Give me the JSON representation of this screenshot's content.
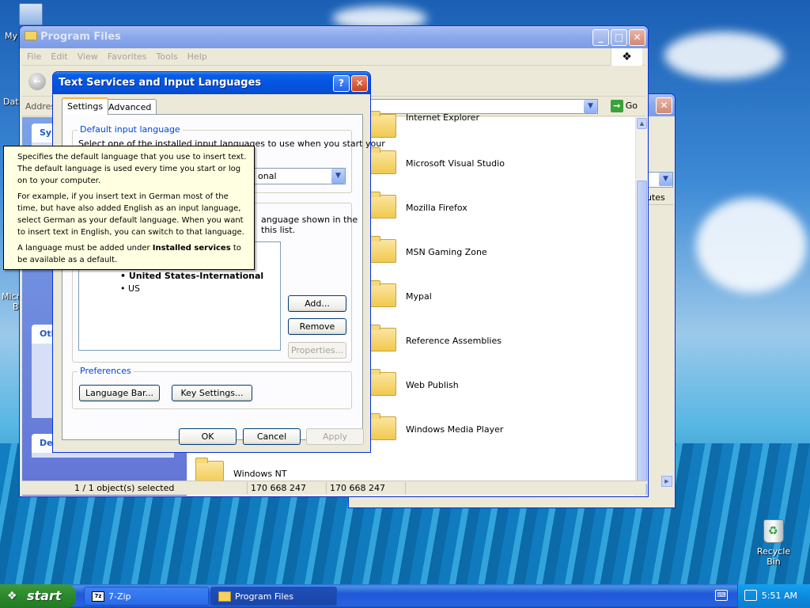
{
  "desktop": {
    "icon_labels_left": [
      "My",
      "Dat",
      "Micro",
      "B"
    ],
    "recycle_bin": "Recycle Bin"
  },
  "explorer": {
    "title": "Program Files",
    "menu": [
      "File",
      "Edit",
      "View",
      "Favorites",
      "Tools",
      "Help"
    ],
    "address_label": "Addres",
    "go_label": "Go",
    "taskpane_headers": [
      "Sy",
      "Oth",
      "De"
    ],
    "folders": [
      "Internet Explorer",
      "Microsoft Visual Studio",
      "Mozilla Firefox",
      "MSN Gaming Zone",
      "Mypal",
      "Reference Assemblies",
      "Web Publish",
      "Windows Media Player",
      "Windows NT"
    ],
    "status": {
      "selected": "1 / 1 object(s) selected",
      "size1": "170 668 247",
      "size2": "170 668 247"
    }
  },
  "back_window": {
    "column_fragment": "utes"
  },
  "dialog": {
    "title": "Text Services and Input Languages",
    "help_btn": "?",
    "tabs": [
      "Settings",
      "Advanced"
    ],
    "default_group": {
      "title": "Default input language",
      "desc_line1": "Select one of the installed input languages to use when you start your",
      "combo_value_fragment": "onal"
    },
    "installed_group": {
      "desc_line1_fragment": "anguage shown in the",
      "desc_line2_fragment": "this list.",
      "items": [
        "United States-International",
        "US"
      ],
      "buttons": {
        "add": "Add...",
        "remove": "Remove",
        "properties": "Properties..."
      }
    },
    "preferences": {
      "title": "Preferences",
      "language_bar": "Language Bar...",
      "key_settings": "Key Settings..."
    },
    "footer": {
      "ok": "OK",
      "cancel": "Cancel",
      "apply": "Apply"
    }
  },
  "tooltip": {
    "p1": "Specifies the default language that you use to insert text. The default language is used every time you start or log on to your computer.",
    "p2": "For example, if you insert text in German most of the time, but have also added English as an input language, select German as your default language. When you want to insert text in English, you can switch to that language.",
    "p3_before": "A language must be added under ",
    "p3_bold": "Installed services",
    "p3_after": " to be available as a default."
  },
  "taskbar": {
    "start": "start",
    "items": [
      "7-Zip",
      "Program Files"
    ],
    "clock": "5:51 AM"
  }
}
